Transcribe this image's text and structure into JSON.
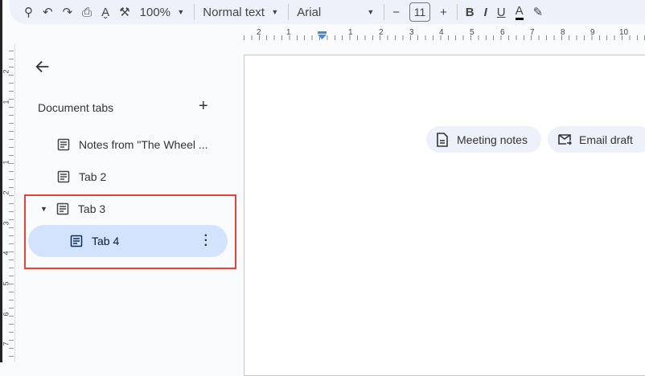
{
  "toolbar": {
    "zoom": "100%",
    "style": "Normal text",
    "font": "Arial",
    "font_size": "11",
    "minus": "−",
    "plus": "+",
    "bold": "B",
    "italic": "I",
    "underline": "U",
    "text_color": "A",
    "text_color_value": "#000000"
  },
  "ruler": {
    "h": [
      "2",
      "1",
      "1",
      "2",
      "3",
      "4",
      "5",
      "6",
      "7",
      "8",
      "9",
      "10"
    ],
    "v": [
      "2",
      "1",
      "1",
      "2",
      "3",
      "4",
      "5",
      "6",
      "7"
    ]
  },
  "sidebar": {
    "title": "Document tabs",
    "add": "+",
    "items": [
      {
        "label": "Notes from \"The Wheel ..."
      },
      {
        "label": "Tab 2"
      },
      {
        "label": "Tab 3",
        "expanded": true
      },
      {
        "label": "Tab 4",
        "selected": true
      }
    ]
  },
  "chips": [
    {
      "label": "Meeting notes"
    },
    {
      "label": "Email draft"
    }
  ],
  "colors": {
    "selected": "#d3e3fd",
    "highlight": "#ea4335",
    "accent": "#4285f4"
  }
}
